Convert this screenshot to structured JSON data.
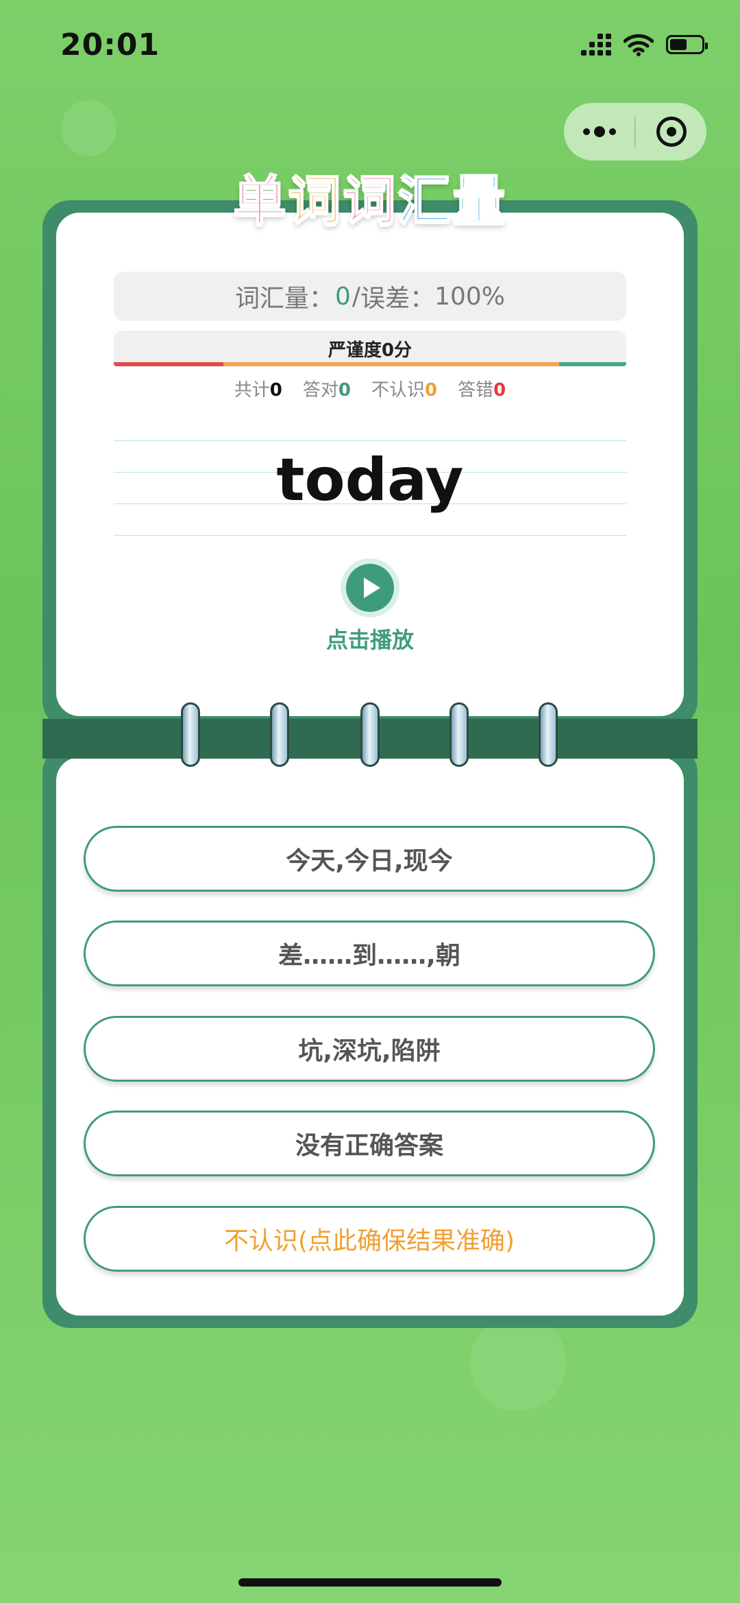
{
  "status_bar": {
    "time": "20:01"
  },
  "logo": {
    "chars": [
      "单",
      "词",
      "词",
      "汇",
      "量"
    ]
  },
  "header": {
    "vocab_label": "词汇量：",
    "vocab_value": "0",
    "separator": "/ ",
    "error_label": "误差：",
    "error_value": "100%"
  },
  "rigor": {
    "label": "严谨度0分"
  },
  "stats": {
    "total_label": "共计",
    "total_value": "0",
    "right_label": "答对",
    "right_value": "0",
    "unknown_label": "不认识",
    "unknown_value": "0",
    "wrong_label": "答错",
    "wrong_value": "0"
  },
  "word": "today",
  "play": {
    "label": "点击播放"
  },
  "options": [
    "今天,今日,现今",
    "差……到……,朝",
    "坑,深坑,陷阱",
    "没有正确答案",
    "不认识(点此确保结果准确)"
  ],
  "colors": {
    "accent": "#3f9c7a",
    "frame": "#3f8c6a",
    "warning": "#f0a030",
    "error": "#e03a3a"
  }
}
